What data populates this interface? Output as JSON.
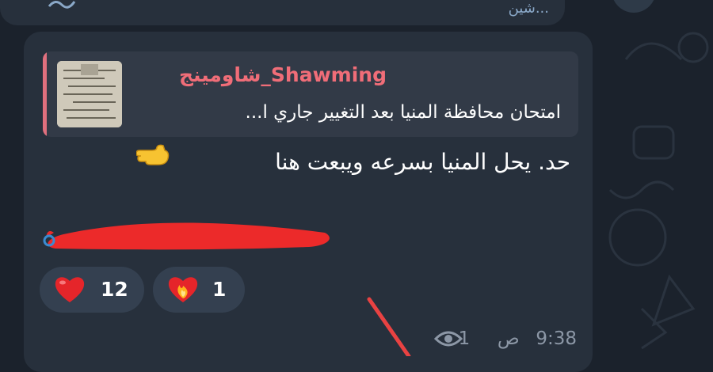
{
  "previous_message": {
    "text": "...شين"
  },
  "reply": {
    "sender": "شاومينج_Shawming",
    "text": "امتحان محافظة المنيا بعد التغيير جاري ا..."
  },
  "message": {
    "text": "حد. يحل المنيا بسرعه ويبعت هنا"
  },
  "reactions": [
    {
      "emoji": "heart",
      "count": "12"
    },
    {
      "emoji": "heart-on-fire",
      "count": "1"
    }
  ],
  "meta": {
    "views": "1",
    "time": "9:38",
    "period": "ص"
  },
  "colors": {
    "background": "#1b222c",
    "bubble": "#27303c",
    "reply_bg": "#323a47",
    "reply_accent": "#e0707e",
    "sender": "#f06d78",
    "reaction_bg": "#344050",
    "redaction": "#ec2a2a"
  }
}
